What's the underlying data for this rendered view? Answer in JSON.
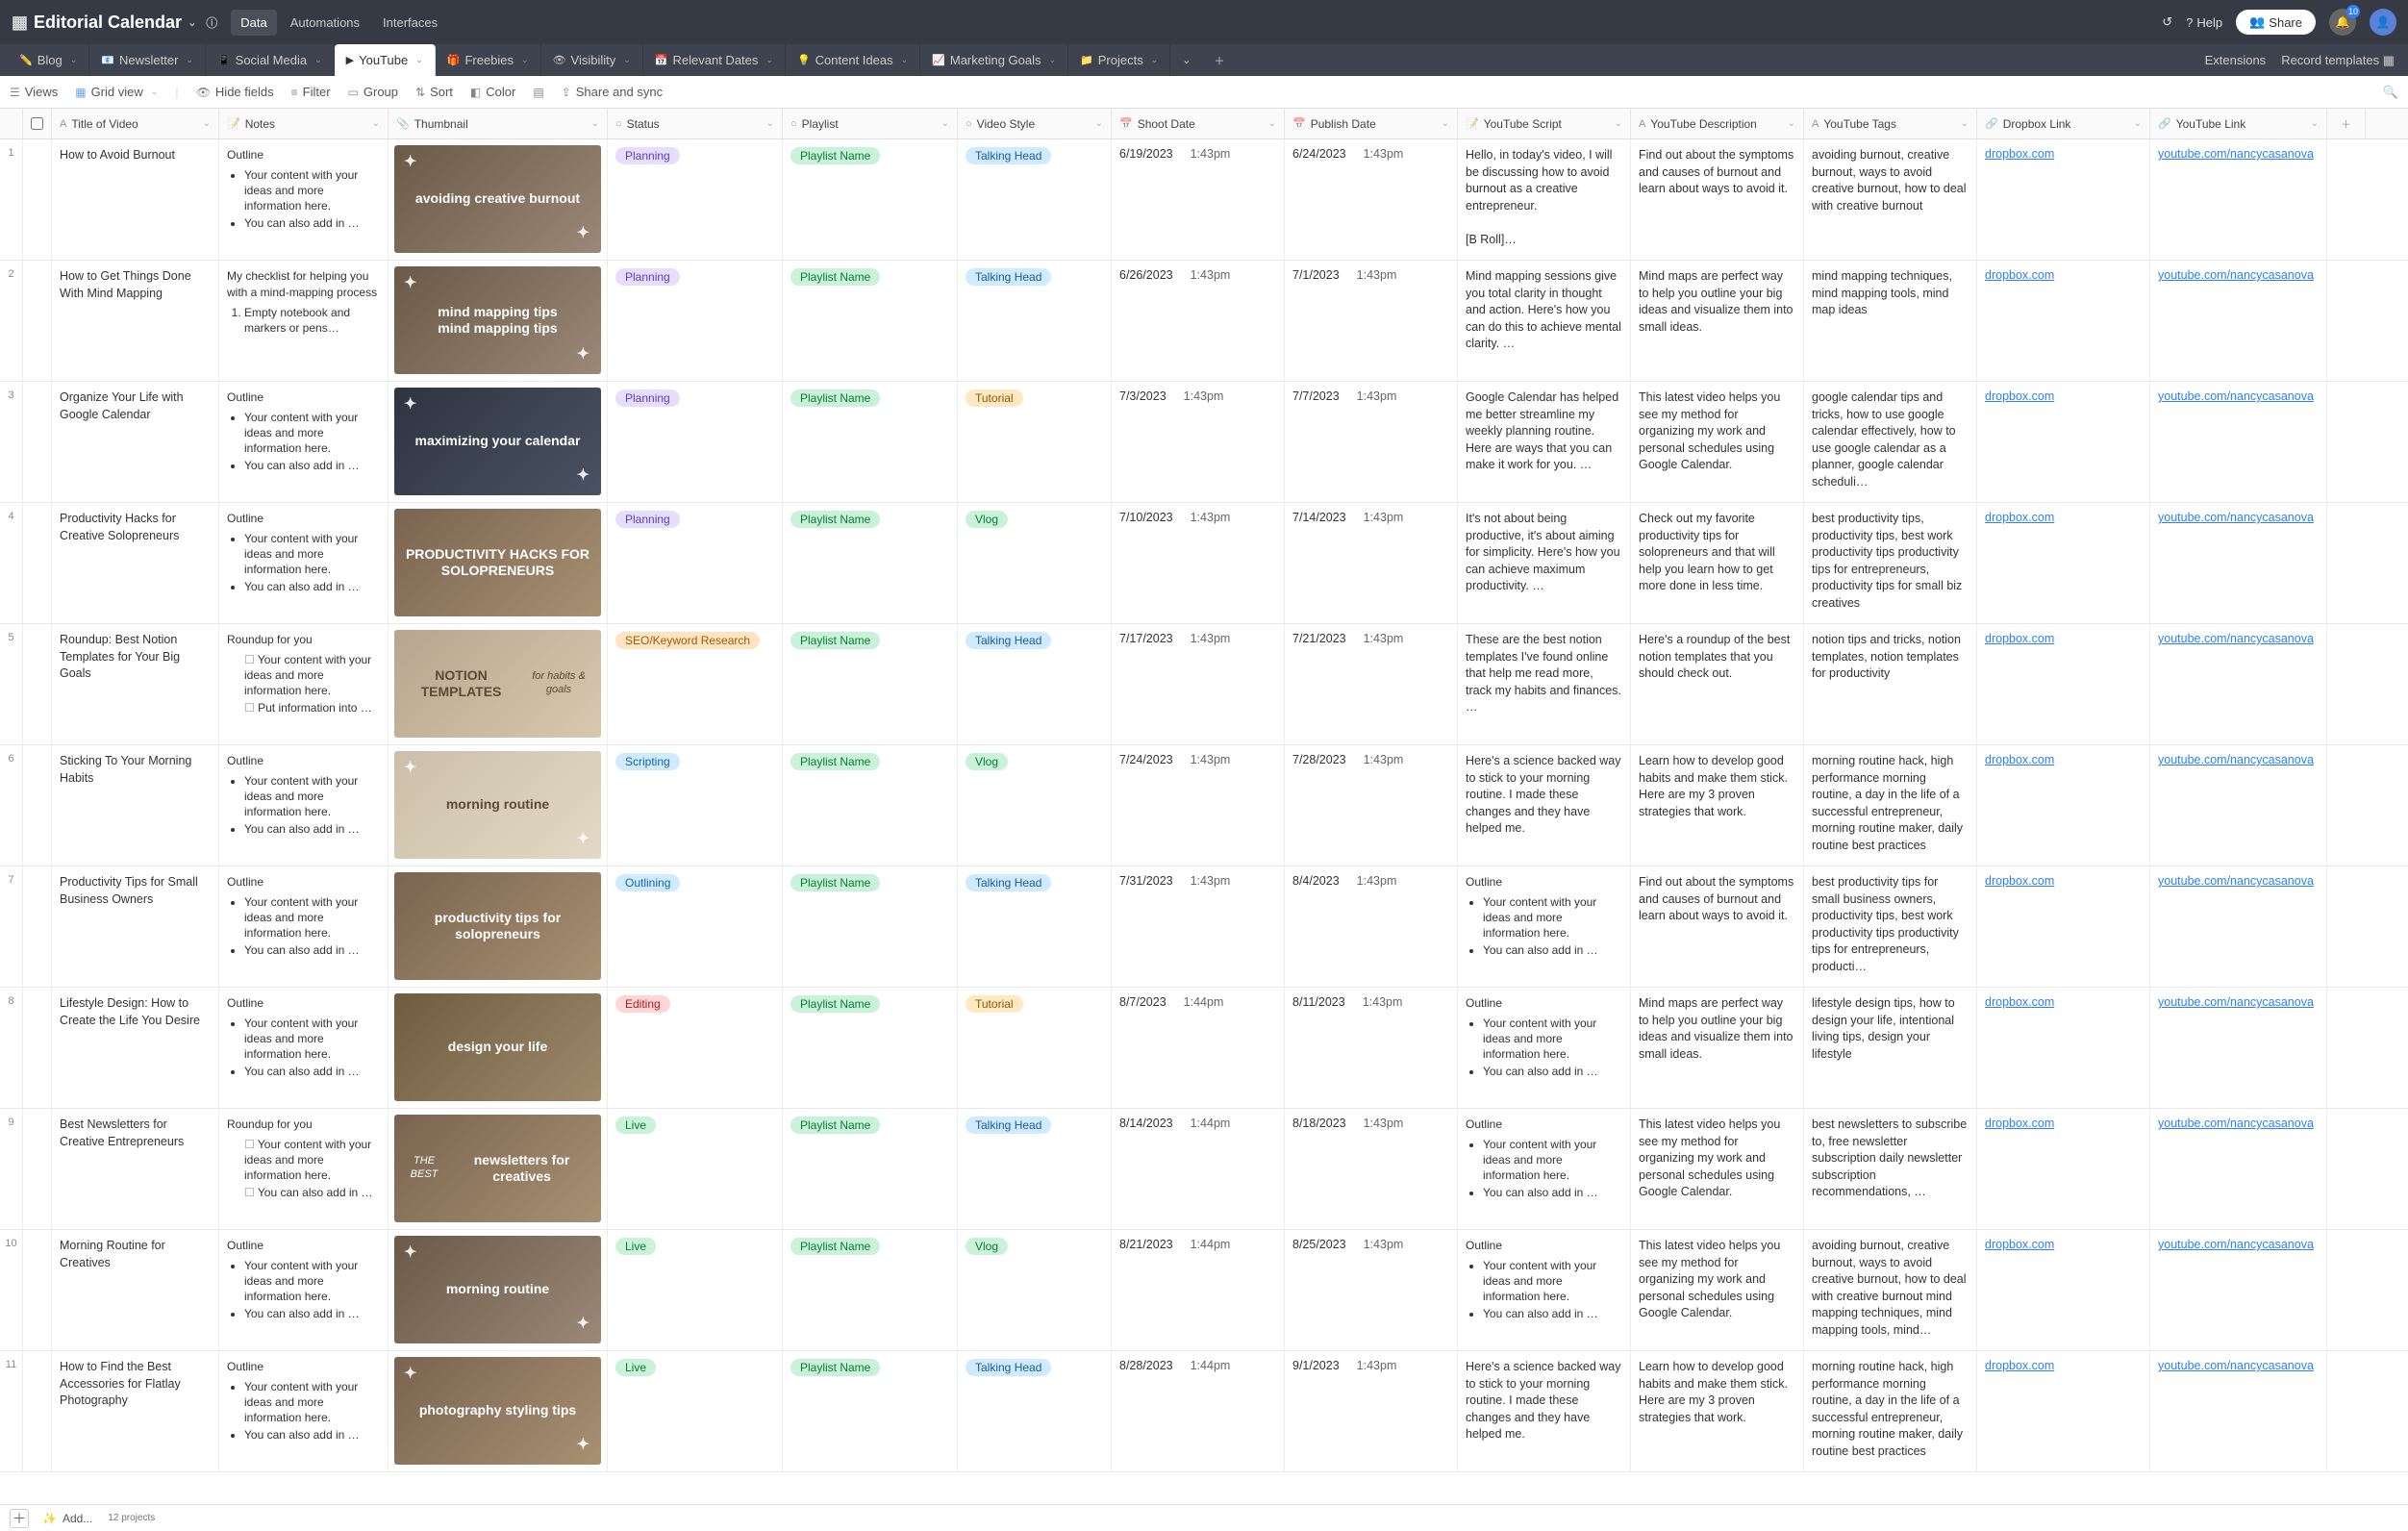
{
  "doc_title": "Editorial Calendar",
  "top_tabs": [
    "Data",
    "Automations",
    "Interfaces"
  ],
  "top_tabs_active": 0,
  "help": "Help",
  "share": "Share",
  "notif_count": "10",
  "tabs": [
    {
      "icon": "✏️",
      "label": "Blog"
    },
    {
      "icon": "📧",
      "label": "Newsletter"
    },
    {
      "icon": "📱",
      "label": "Social Media"
    },
    {
      "icon": "▶",
      "label": "YouTube",
      "active": true
    },
    {
      "icon": "🎁",
      "label": "Freebies"
    },
    {
      "icon": "👁",
      "label": "Visibility"
    },
    {
      "icon": "📅",
      "label": "Relevant Dates"
    },
    {
      "icon": "💡",
      "label": "Content Ideas"
    },
    {
      "icon": "📈",
      "label": "Marketing Goals"
    },
    {
      "icon": "📁",
      "label": "Projects"
    }
  ],
  "ext": "Extensions",
  "rtpl": "Record templates",
  "toolbar": {
    "views": "Views",
    "grid": "Grid view",
    "hide": "Hide fields",
    "filter": "Filter",
    "group": "Group",
    "sort": "Sort",
    "color": "Color",
    "share": "Share and sync"
  },
  "headers": [
    {
      "icon": "A",
      "label": "Title of Video",
      "cls": "w-title"
    },
    {
      "icon": "📝",
      "label": "Notes",
      "cls": "w-notes"
    },
    {
      "icon": "📎",
      "label": "Thumbnail",
      "cls": "w-thumb"
    },
    {
      "icon": "○",
      "label": "Status",
      "cls": "w-status"
    },
    {
      "icon": "○",
      "label": "Playlist",
      "cls": "w-playlist"
    },
    {
      "icon": "○",
      "label": "Video Style",
      "cls": "w-vstyle"
    },
    {
      "icon": "📅",
      "label": "Shoot Date",
      "cls": "w-shoot"
    },
    {
      "icon": "📅",
      "label": "Publish Date",
      "cls": "w-publish"
    },
    {
      "icon": "📝",
      "label": "YouTube Script",
      "cls": "w-script"
    },
    {
      "icon": "A",
      "label": "YouTube Description",
      "cls": "w-desc"
    },
    {
      "icon": "A",
      "label": "YouTube Tags",
      "cls": "w-tags"
    },
    {
      "icon": "🔗",
      "label": "Dropbox Link",
      "cls": "w-drop"
    },
    {
      "icon": "🔗",
      "label": "YouTube Link",
      "cls": "w-yt"
    }
  ],
  "dropbox": "dropbox.com",
  "youtube": "youtube.com/nancycasanova",
  "playlist": "Playlist Name",
  "rows": [
    {
      "n": "1",
      "title": "How to Avoid Burnout",
      "notes_hd": "Outline",
      "notes_type": "ul",
      "notes": [
        "Your content with your ideas and more information here.",
        "You can also add in …"
      ],
      "thumb": "avoiding creative burnout",
      "tcls": "b sparkle",
      "status": "Planning",
      "scls": "p-planning",
      "vstyle": "Talking Head",
      "vcls": "p-talking",
      "shoot_d": "6/19/2023",
      "shoot_t": "1:43pm",
      "pub_d": "6/24/2023",
      "pub_t": "1:43pm",
      "script": "Hello, in today's video, I will be discussing how to avoid burnout as a creative entrepreneur.\n\n[B Roll]…",
      "desc": "Find out about the symptoms and causes of burnout and learn about ways to avoid it.",
      "tags": "avoiding burnout, creative burnout, ways to avoid creative burnout, how to deal with creative burnout"
    },
    {
      "n": "2",
      "title": "How to Get Things Done With Mind Mapping",
      "notes_hd": "My checklist for helping you with a mind-mapping process",
      "notes_type": "ol",
      "notes": [
        "Empty notebook and markers or pens…"
      ],
      "thumb": "mind mapping tips\nmind mapping tips",
      "tcls": "b sparkle",
      "status": "Planning",
      "scls": "p-planning",
      "vstyle": "Talking Head",
      "vcls": "p-talking",
      "shoot_d": "6/26/2023",
      "shoot_t": "1:43pm",
      "pub_d": "7/1/2023",
      "pub_t": "1:43pm",
      "script": "Mind mapping sessions give you total clarity in thought and action. Here's how you can do this to achieve mental clarity. …",
      "desc": "Mind maps are perfect way to help you outline your big ideas and visualize them into small ideas.",
      "tags": "mind mapping techniques, mind mapping tools, mind map ideas"
    },
    {
      "n": "3",
      "title": "Organize Your Life with Google Calendar",
      "notes_hd": "Outline",
      "notes_type": "ul",
      "notes": [
        "Your content with your ideas and more information here.",
        "You can also add in …"
      ],
      "thumb": "maximizing your calendar",
      "tcls": "c sparkle",
      "status": "Planning",
      "scls": "p-planning",
      "vstyle": "Tutorial",
      "vcls": "p-tutorial",
      "shoot_d": "7/3/2023",
      "shoot_t": "1:43pm",
      "pub_d": "7/7/2023",
      "pub_t": "1:43pm",
      "script": "Google Calendar has helped me better streamline my weekly planning routine. Here are ways that you can make it work for you. …",
      "desc": "This latest video helps you see my method for organizing my work and personal schedules using Google Calendar.",
      "tags": "google calendar tips and tricks, how to use google calendar effectively, how to use google calendar as a planner, google calendar scheduli…"
    },
    {
      "n": "4",
      "title": "Productivity Hacks for Creative Solopreneurs",
      "notes_hd": "Outline",
      "notes_type": "ul",
      "notes": [
        "Your content with your ideas and more information here.",
        "You can also add in …"
      ],
      "thumb": "PRODUCTIVITY HACKS FOR SOLOPRENEURS",
      "tcls": "d",
      "status": "Planning",
      "scls": "p-planning",
      "vstyle": "Vlog",
      "vcls": "p-vlog",
      "shoot_d": "7/10/2023",
      "shoot_t": "1:43pm",
      "pub_d": "7/14/2023",
      "pub_t": "1:43pm",
      "script": "It's not about being productive, it's about aiming for simplicity. Here's how you can achieve maximum productivity. …",
      "desc": "Check out my favorite productivity tips for solopreneurs and that will help you learn how to get more done in less time.",
      "tags": "best productivity tips, productivity tips, best work productivity tips productivity tips for entrepreneurs, productivity tips for small biz creatives"
    },
    {
      "n": "5",
      "title": "Roundup: Best Notion Templates for Your Big Goals",
      "notes_hd": "Roundup for you",
      "notes_type": "chk",
      "notes": [
        "Your content with your ideas and more information here.",
        "Put information into …"
      ],
      "thumb": "NOTION TEMPLATES",
      "thumb_sub": "for habits & goals",
      "tcls": "e",
      "status": "SEO/Keyword Research",
      "scls": "p-seo",
      "vstyle": "Talking Head",
      "vcls": "p-talking",
      "shoot_d": "7/17/2023",
      "shoot_t": "1:43pm",
      "pub_d": "7/21/2023",
      "pub_t": "1:43pm",
      "script": "These are the best notion templates I've found online that help me read more, track my habits and finances. …",
      "desc": "Here's a roundup of the best notion templates that you should check out.",
      "tags": "notion tips and tricks, notion templates, notion templates for productivity"
    },
    {
      "n": "6",
      "title": "Sticking To Your Morning Habits",
      "notes_hd": "Outline",
      "notes_type": "ul",
      "notes": [
        "Your content with your ideas and more information here.",
        "You can also add in …"
      ],
      "thumb": "morning routine",
      "tcls": "f sparkle",
      "status": "Scripting",
      "scls": "p-scripting",
      "vstyle": "Vlog",
      "vcls": "p-vlog",
      "shoot_d": "7/24/2023",
      "shoot_t": "1:43pm",
      "pub_d": "7/28/2023",
      "pub_t": "1:43pm",
      "script": "Here's a science backed way to stick to your morning routine. I made these changes and they have helped me.",
      "desc": "Learn how to develop good habits and make them stick. Here are my 3 proven strategies that work.",
      "tags": "morning routine hack, high performance morning routine, a day in the life of a successful entrepreneur, morning routine maker, daily routine best practices"
    },
    {
      "n": "7",
      "title": "Productivity Tips for Small Business Owners",
      "notes_hd": "Outline",
      "notes_type": "ul",
      "notes": [
        "Your content with your ideas and more information here.",
        "You can also add in …"
      ],
      "thumb": "productivity tips for solopreneurs",
      "tcls": "d",
      "status": "Outlining",
      "scls": "p-outlining",
      "vstyle": "Talking Head",
      "vcls": "p-talking",
      "shoot_d": "7/31/2023",
      "shoot_t": "1:43pm",
      "pub_d": "8/4/2023",
      "pub_t": "1:43pm",
      "script": "Outline",
      "script_type": "ul",
      "script_items": [
        "Your content with your ideas and more information here.",
        "You can also add in …"
      ],
      "desc": "Find out about the symptoms and causes of burnout and learn about ways to avoid it.",
      "tags": "best productivity tips for small business owners, productivity tips, best work productivity tips productivity tips for entrepreneurs, producti…"
    },
    {
      "n": "8",
      "title": "Lifestyle Design: How to Create the Life You Desire",
      "notes_hd": "Outline",
      "notes_type": "ul",
      "notes": [
        "Your content with your ideas and more information here.",
        "You can also add in …"
      ],
      "thumb": "design your life",
      "tcls": "g",
      "status": "Editing",
      "scls": "p-editing",
      "vstyle": "Tutorial",
      "vcls": "p-tutorial",
      "shoot_d": "8/7/2023",
      "shoot_t": "1:44pm",
      "pub_d": "8/11/2023",
      "pub_t": "1:43pm",
      "script": "Outline",
      "script_type": "ul",
      "script_items": [
        "Your content with your ideas and more information here.",
        "You can also add in …"
      ],
      "desc": "Mind maps are perfect way to help you outline your big ideas and visualize them into small ideas.",
      "tags": "lifestyle design tips, how to design your life, intentional living tips, design your lifestyle"
    },
    {
      "n": "9",
      "title": "Best Newsletters for Creative Entrepreneurs",
      "notes_hd": "Roundup for you",
      "notes_type": "chk",
      "notes": [
        "Your content with your ideas and more information here.",
        "You can also add in …"
      ],
      "thumb": "newsletters for creatives",
      "thumb_pre": "THE BEST",
      "tcls": "d",
      "status": "Live",
      "scls": "p-live",
      "vstyle": "Talking Head",
      "vcls": "p-talking",
      "shoot_d": "8/14/2023",
      "shoot_t": "1:44pm",
      "pub_d": "8/18/2023",
      "pub_t": "1:43pm",
      "script": "Outline",
      "script_type": "ul",
      "script_items": [
        "Your content with your ideas and more information here.",
        "You can also add in …"
      ],
      "desc": "This latest video helps you see my method for organizing my work and personal schedules using Google Calendar.",
      "tags": "best newsletters to subscribe to, free newsletter subscription daily newsletter subscription recommendations, …"
    },
    {
      "n": "10",
      "title": "Morning Routine for Creatives",
      "notes_hd": "Outline",
      "notes_type": "ul",
      "notes": [
        "Your content with your ideas and more information here.",
        "You can also add in …"
      ],
      "thumb": "morning routine",
      "tcls": "b sparkle",
      "status": "Live",
      "scls": "p-live",
      "vstyle": "Vlog",
      "vcls": "p-vlog",
      "shoot_d": "8/21/2023",
      "shoot_t": "1:44pm",
      "pub_d": "8/25/2023",
      "pub_t": "1:43pm",
      "script": "Outline",
      "script_type": "ul",
      "script_items": [
        "Your content with your ideas and more information here.",
        "You can also add in …"
      ],
      "desc": "This latest video helps you see my method for organizing my work and personal schedules using Google Calendar.",
      "tags": "avoiding burnout, creative burnout, ways to avoid creative burnout, how to deal with creative burnout mind mapping techniques, mind mapping tools, mind…"
    },
    {
      "n": "11",
      "title": "How to Find the Best Accessories for Flatlay Photography",
      "notes_hd": "Outline",
      "notes_type": "ul",
      "notes": [
        "Your content with your ideas and more information here.",
        "You can also add in …"
      ],
      "thumb": "photography styling tips",
      "tcls": "d sparkle",
      "status": "Live",
      "scls": "p-live",
      "vstyle": "Talking Head",
      "vcls": "p-talking",
      "shoot_d": "8/28/2023",
      "shoot_t": "1:44pm",
      "pub_d": "9/1/2023",
      "pub_t": "1:43pm",
      "script": "Here's a science backed way to stick to your morning routine. I made these changes and they have helped me.",
      "desc": "Learn how to develop good habits and make them stick. Here are my 3 proven strategies that work.",
      "tags": "morning routine hack, high performance morning routine, a day in the life of a successful entrepreneur, morning routine maker, daily routine best practices"
    }
  ],
  "footer": {
    "add": "Add...",
    "count": "12 projects"
  }
}
